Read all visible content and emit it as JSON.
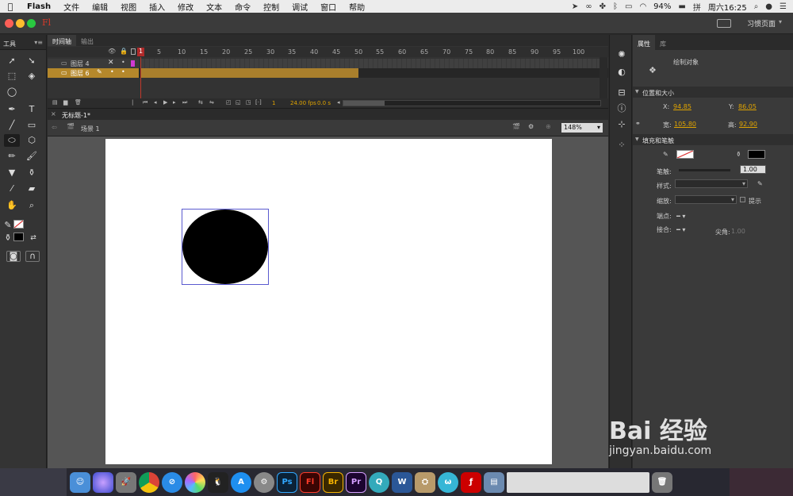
{
  "menubar": {
    "items": [
      "Flash",
      "文件",
      "编辑",
      "视图",
      "插入",
      "修改",
      "文本",
      "命令",
      "控制",
      "调试",
      "窗口",
      "帮助"
    ],
    "battery": "94%",
    "clock": "周六16:25"
  },
  "app": {
    "logo": "Fl",
    "workspace": "习惯页面"
  },
  "tools_panel": {
    "title": "工具"
  },
  "timeline": {
    "tabs": [
      "时间轴",
      "输出"
    ],
    "frame_numbers": [
      "1",
      "5",
      "10",
      "15",
      "20",
      "25",
      "30",
      "35",
      "40",
      "45",
      "50",
      "55",
      "60",
      "65",
      "70",
      "75",
      "80",
      "85",
      "90",
      "95",
      "100"
    ],
    "layers": [
      {
        "name": "图层 4"
      },
      {
        "name": "图层 6"
      }
    ],
    "footer": {
      "current_frame": "1",
      "fps": "24.00 fps",
      "time": "0.0 s"
    }
  },
  "document": {
    "tab": "无标题-1*",
    "scene": "场景 1",
    "zoom": "148%"
  },
  "properties": {
    "tabs": [
      "属性",
      "库"
    ],
    "object_type": "绘制对象",
    "section_position": "位置和大小",
    "x_label": "X:",
    "x_value": "94.85",
    "y_label": "Y:",
    "y_value": "86.05",
    "w_label": "宽:",
    "w_value": "105.80",
    "h_label": "高:",
    "h_value": "92.90",
    "section_fill": "填充和笔触",
    "stroke_label": "笔触:",
    "stroke_value": "1.00",
    "style_label": "样式:",
    "scale_label": "缩放:",
    "hint_label": "提示",
    "cap_label": "端点:",
    "join_label": "接合:",
    "miter_label": "尖角:",
    "miter_value": "1.00"
  },
  "watermark": {
    "text": "Bai 经验",
    "url": "jingyan.baidu.com"
  },
  "colors": {
    "accent_orange": "#e0a400",
    "layer_selected": "#b5882b",
    "playhead": "#c0392b"
  },
  "dock_apps": [
    "finder-icon",
    "siri-icon",
    "launchpad-icon",
    "chrome-icon",
    "safari-icon",
    "photos-icon",
    "qq-icon",
    "appstore-icon",
    "system-preferences-icon",
    "photoshop-icon",
    "flash-icon",
    "bridge-icon",
    "premiere-icon",
    "quicktime-icon",
    "word-icon",
    "archive-icon",
    "wunderlist-icon",
    "flash-player-icon",
    "preview-icon"
  ],
  "dock_labels": {
    "photoshop": "Ps",
    "flash": "Fl",
    "bridge": "Br",
    "premiere": "Pr"
  }
}
